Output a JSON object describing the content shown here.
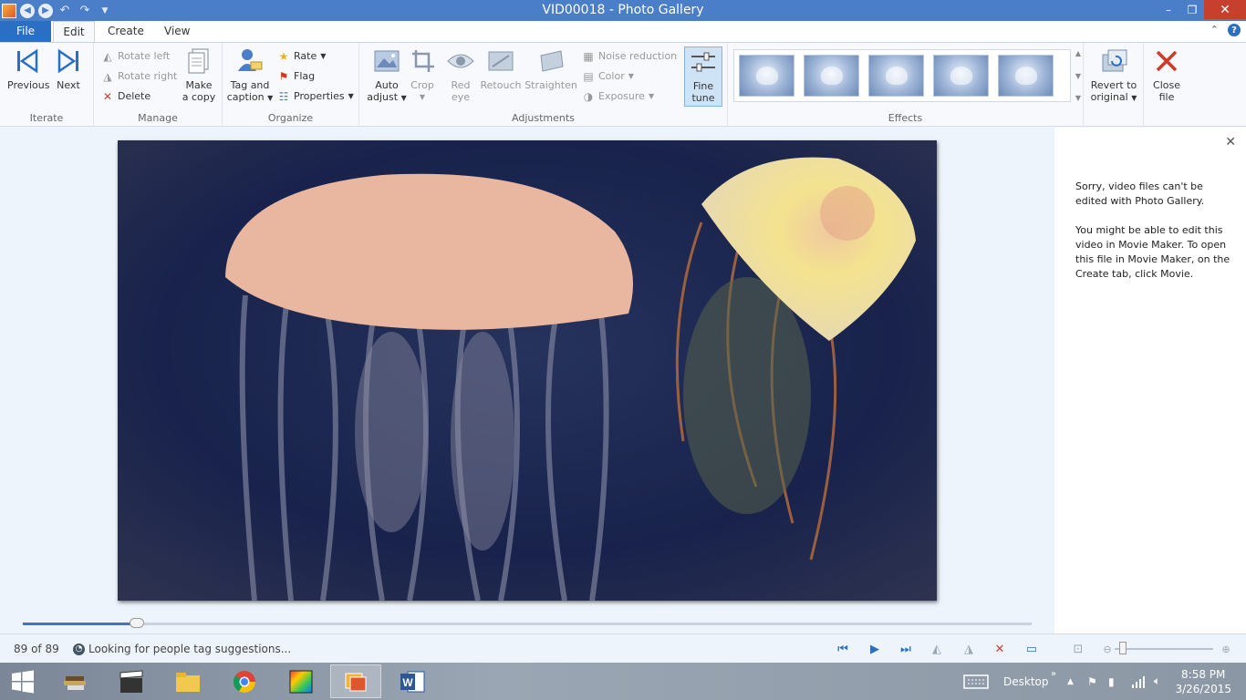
{
  "window": {
    "title": "VID00018 - Photo Gallery",
    "controls": {
      "minimize": "–",
      "restore": "❐",
      "close": "✕"
    }
  },
  "tabs": {
    "file": "File",
    "edit": "Edit",
    "create": "Create",
    "view": "View"
  },
  "ribbon": {
    "iterate": {
      "label": "Iterate",
      "previous": "Previous",
      "next": "Next"
    },
    "manage": {
      "label": "Manage",
      "rotate_left": "Rotate left",
      "rotate_right": "Rotate right",
      "delete": "Delete",
      "make_copy_1": "Make",
      "make_copy_2": "a copy"
    },
    "organize": {
      "label": "Organize",
      "tag_caption_1": "Tag and",
      "tag_caption_2": "caption",
      "rate": "Rate",
      "flag": "Flag",
      "properties": "Properties"
    },
    "adjustments": {
      "label": "Adjustments",
      "auto_adjust_1": "Auto",
      "auto_adjust_2": "adjust",
      "crop": "Crop",
      "red_eye_1": "Red",
      "red_eye_2": "eye",
      "retouch": "Retouch",
      "straighten": "Straighten",
      "noise_reduction": "Noise reduction",
      "color": "Color",
      "exposure": "Exposure",
      "fine_tune_1": "Fine",
      "fine_tune_2": "tune"
    },
    "effects": {
      "label": "Effects"
    },
    "revert": {
      "line1": "Revert to",
      "line2": "original"
    },
    "close_file": {
      "line1": "Close",
      "line2": "file"
    }
  },
  "side_panel": {
    "message1": "Sorry, video files can't be edited with Photo Gallery.",
    "message2": "You might be able to edit this video in Movie Maker. To open this file in Movie Maker, on the Create tab, click Movie."
  },
  "status": {
    "count": "89 of 89",
    "message": "Looking for people tag suggestions...",
    "seek_progress": 0.113
  },
  "taskbar": {
    "desktop_label": "Desktop",
    "time": "8:58 PM",
    "date": "3/26/2015"
  }
}
